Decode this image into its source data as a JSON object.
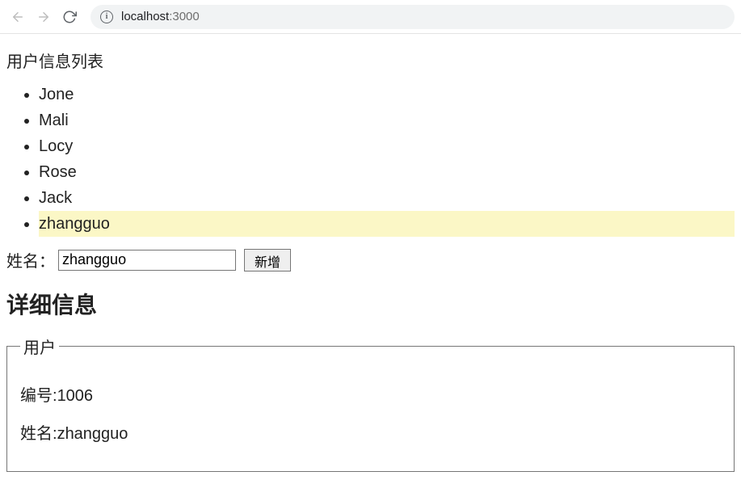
{
  "browser": {
    "url_host": "localhost",
    "url_port": ":3000"
  },
  "page": {
    "list_title": "用户信息列表",
    "users": [
      {
        "name": "Jone",
        "selected": false
      },
      {
        "name": "Mali",
        "selected": false
      },
      {
        "name": "Locy",
        "selected": false
      },
      {
        "name": "Rose",
        "selected": false
      },
      {
        "name": "Jack",
        "selected": false
      },
      {
        "name": "zhangguo",
        "selected": true
      }
    ],
    "form": {
      "label": "姓名：",
      "input_value": "zhangguo",
      "button_label": "新增"
    },
    "detail": {
      "heading": "详细信息",
      "legend": "用户",
      "id_label": "编号:",
      "id_value": "1006",
      "name_label": "姓名:",
      "name_value": "zhangguo"
    }
  }
}
